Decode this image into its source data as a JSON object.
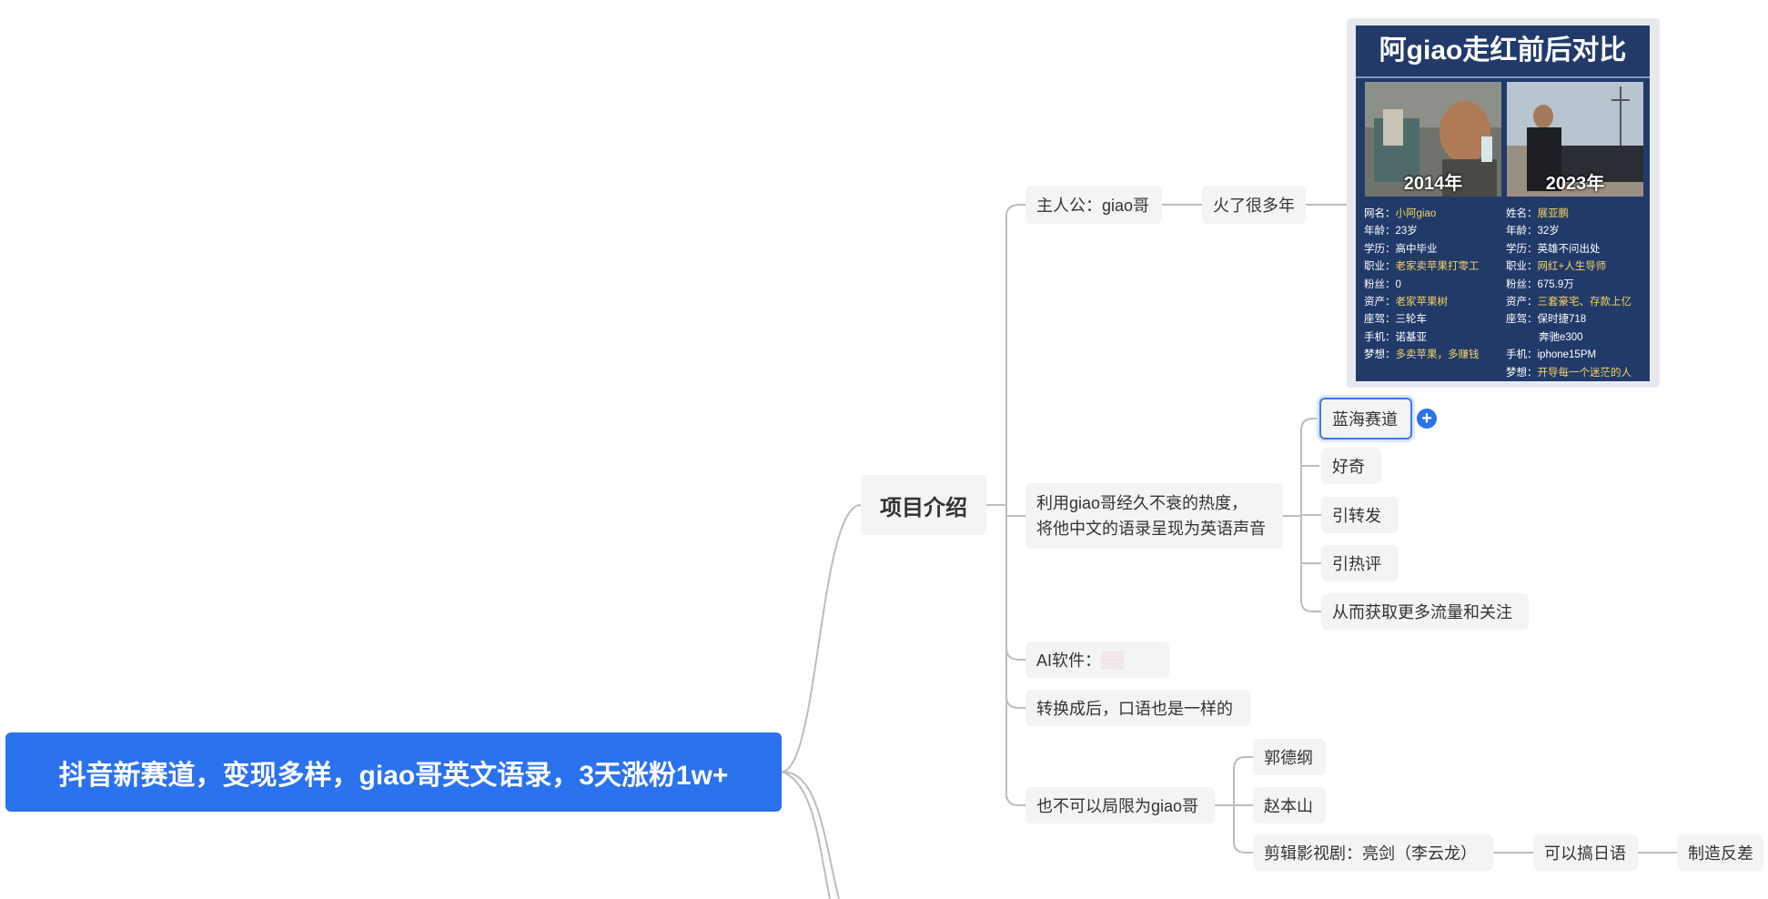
{
  "root": {
    "label": "抖音新赛道，变现多样，giao哥英文语录，3天涨粉1w+"
  },
  "project_intro": {
    "label": "项目介绍",
    "protagonist": {
      "label": "主人公：giao哥",
      "child": "火了很多年"
    },
    "idea": {
      "line1": "利用giao哥经久不衰的热度，",
      "line2": "将他中文的语录呈现为英语声音",
      "children": [
        "蓝海赛道",
        "好奇",
        "引转发",
        "引热评",
        "从而获取更多流量和关注"
      ]
    },
    "ai_software": {
      "label": "AI软件：",
      "value": "▒▒"
    },
    "after_convert": {
      "label": "转换成后，口语也是一样的"
    },
    "not_limited": {
      "label": "也不可以局限为giao哥",
      "children": [
        "郭德纲",
        "赵本山",
        "剪辑影视剧：亮剑（李云龙）"
      ],
      "subchain": [
        "可以搞日语",
        "制造反差"
      ]
    }
  },
  "add_button": {
    "symbol": "+"
  },
  "poster": {
    "title": "阿giao走红前后对比",
    "left": {
      "year": "2014年",
      "rows": [
        {
          "k": "网名：",
          "v": "小阿giao",
          "hl": true
        },
        {
          "k": "年龄：",
          "v": "23岁",
          "hl": false
        },
        {
          "k": "学历：",
          "v": "高中毕业",
          "hl": false
        },
        {
          "k": "职业：",
          "v": "老家卖苹果打零工",
          "hl": true
        },
        {
          "k": "粉丝：",
          "v": "0",
          "hl": false
        },
        {
          "k": "资产：",
          "v": "老家苹果树",
          "hl": true
        },
        {
          "k": "座驾：",
          "v": "三轮车",
          "hl": false
        },
        {
          "k": "手机：",
          "v": "诺基亚",
          "hl": false
        },
        {
          "k": "梦想：",
          "v": "多卖苹果，多赚钱",
          "hl": true
        }
      ]
    },
    "right": {
      "year": "2023年",
      "rows": [
        {
          "k": "姓名：",
          "v": "展亚鹏",
          "hl": true
        },
        {
          "k": "年龄：",
          "v": "32岁",
          "hl": false
        },
        {
          "k": "学历：",
          "v": "英雄不问出处",
          "hl": false
        },
        {
          "k": "职业：",
          "v": "网红+人生导师",
          "hl": true
        },
        {
          "k": "粉丝：",
          "v": "675.9万",
          "hl": false
        },
        {
          "k": "资产：",
          "v": "三套豪宅、存款上亿",
          "hl": true
        },
        {
          "k": "座驾：",
          "v": "保时捷718",
          "hl": false
        },
        {
          "k": "",
          "v": "奔驰e300",
          "hl": false
        },
        {
          "k": "手机：",
          "v": "iphone15PM",
          "hl": false
        },
        {
          "k": "梦想：",
          "v": "开导每一个迷茫的人",
          "hl": true
        }
      ]
    }
  },
  "colors": {
    "root_bg": "#2b72ee",
    "node_bg": "#f3f4f6",
    "line": "#b8b8b8",
    "poster_bg": "#223a6a"
  }
}
